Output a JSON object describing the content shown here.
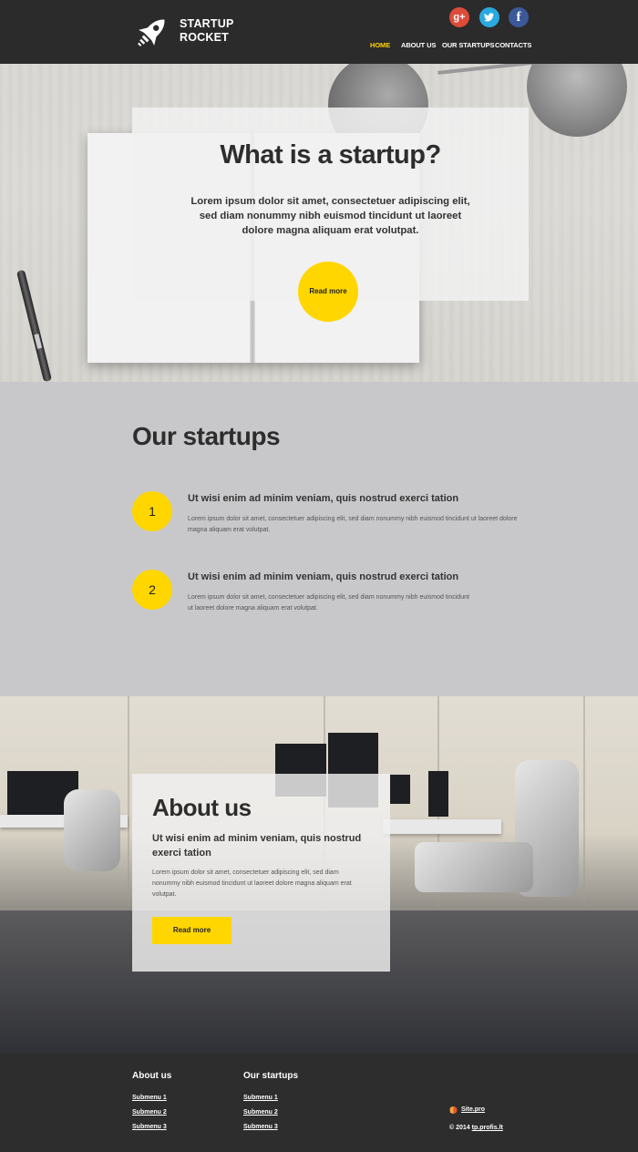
{
  "header": {
    "logo_line1": "STARTUP",
    "logo_line2": "ROCKET",
    "social": {
      "google": "g+",
      "twitter": "t",
      "facebook": "f"
    },
    "nav": [
      "HOME",
      "ABOUT US",
      "OUR STARTUPS",
      "CONTACTS"
    ],
    "active_nav": "HOME"
  },
  "hero": {
    "title": "What is a startup?",
    "text": "Lorem ipsum dolor sit amet, consectetuer adipiscing elit, sed diam nonummy nibh euismod tincidunt ut laoreet dolore magna aliquam erat volutpat.",
    "button": "Read more"
  },
  "startups": {
    "title": "Our startups",
    "items": [
      {
        "num": "1",
        "title": "Ut wisi enim ad minim veniam, quis nostrud exerci tation",
        "text": "Lorem ipsum dolor sit amet, consectetuer adipiscing elit, sed diam nonummy nibh euismod tincidunt ut laoreet dolore magna aliquam erat volutpat."
      },
      {
        "num": "2",
        "title": "Ut wisi enim ad minim veniam, quis nostrud exerci tation",
        "text": "Lorem ipsum dolor sit amet, consectetuer adipiscing elit, sed diam nonummy nibh euismod tincidunt ut laoreet dolore magna aliquam erat volutpat."
      }
    ]
  },
  "about": {
    "title": "About us",
    "subtitle": "Ut wisi enim ad minim veniam, quis nostrud exerci tation",
    "text": "Lorem ipsum dolor sit amet, consectetuer adipiscing elit, sed diam nonummy nibh euismod tincidunt ut laoreet dolore magna aliquam erat volutpat.",
    "button": "Read more"
  },
  "footer": {
    "col1_title": "About us",
    "col1_links": [
      "Submenu 1",
      "Submenu 2",
      "Submenu 3"
    ],
    "col2_title": "Our startups",
    "col2_links": [
      "Submenu 1",
      "Submenu 2",
      "Submenu 3"
    ],
    "site_link": "Site.pro",
    "copyright": "© 2014",
    "copyright_link": "tp.profis.lt"
  },
  "colors": {
    "accent": "#ffd600",
    "dark": "#2d2d2d",
    "gray_section": "#c8c8ca",
    "google": "#dd4b39",
    "twitter": "#2aa9e0",
    "facebook": "#3b5998"
  }
}
